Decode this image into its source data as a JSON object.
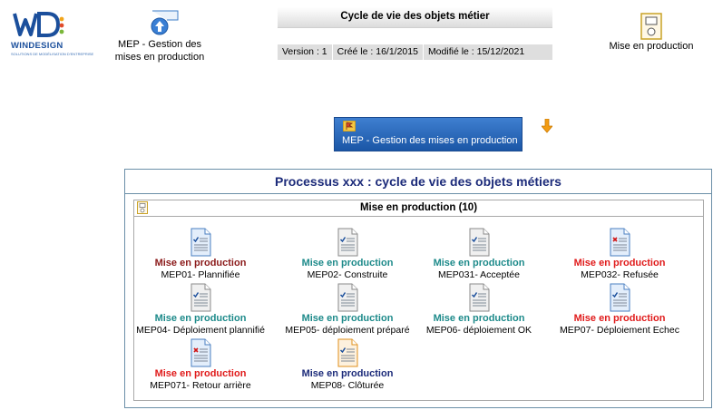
{
  "logo": {
    "brand_win": "WIN",
    "brand_design": "DESIGN",
    "tagline": "SOLUTIONS DE MODÉLISATION D'ENTREPRISE"
  },
  "header": {
    "mep_link_line1": "MEP - Gestion des",
    "mep_link_line2": "mises en production",
    "title": "Cycle de vie des objets métier",
    "version": "Version : 1",
    "created": "Créé le : 16/1/2015",
    "modified": "Modifié le : 15/12/2021",
    "right_label": "Mise en production"
  },
  "button": {
    "label": "MEP - Gestion des mises en production"
  },
  "process": {
    "title": "Processus xxx : cycle de vie des objets métiers",
    "group_title": "Mise en production (10)",
    "items": [
      {
        "status": "Mise en production",
        "name": "MEP01- Plannifiée",
        "status_color": "#8b1a1a",
        "icon": "doc-blue-check-icon"
      },
      {
        "status": "Mise en production",
        "name": "MEP02- Construite",
        "status_color": "#1d8a8a",
        "icon": "doc-gray-check-icon"
      },
      {
        "status": "Mise en production",
        "name": "MEP031- Acceptée",
        "status_color": "#1d8a8a",
        "icon": "doc-gray-check-icon"
      },
      {
        "status": "Mise en production",
        "name": "MEP032- Refusée",
        "status_color": "#e01b1b",
        "icon": "doc-blue-cross-icon"
      },
      {
        "status": "Mise en production",
        "name": "MEP04- Déploiement plannifié",
        "status_color": "#1d8a8a",
        "icon": "doc-gray-check-icon"
      },
      {
        "status": "Mise en production",
        "name": "MEP05- déploiement préparé",
        "status_color": "#1d8a8a",
        "icon": "doc-gray-check-icon"
      },
      {
        "status": "Mise en production",
        "name": "MEP06- déploiement OK",
        "status_color": "#1d8a8a",
        "icon": "doc-gray-check-icon"
      },
      {
        "status": "Mise en production",
        "name": "MEP07- Déploiement Echec",
        "status_color": "#e01b1b",
        "icon": "doc-blue-check-icon"
      },
      {
        "status": "Mise en production",
        "name": "MEP071- Retour arrière",
        "status_color": "#e01b1b",
        "icon": "doc-blue-cross-icon"
      },
      {
        "status": "Mise en production",
        "name": "MEP08- Clôturée",
        "status_color": "#1c2b7a",
        "icon": "doc-orange-check-icon"
      }
    ]
  }
}
